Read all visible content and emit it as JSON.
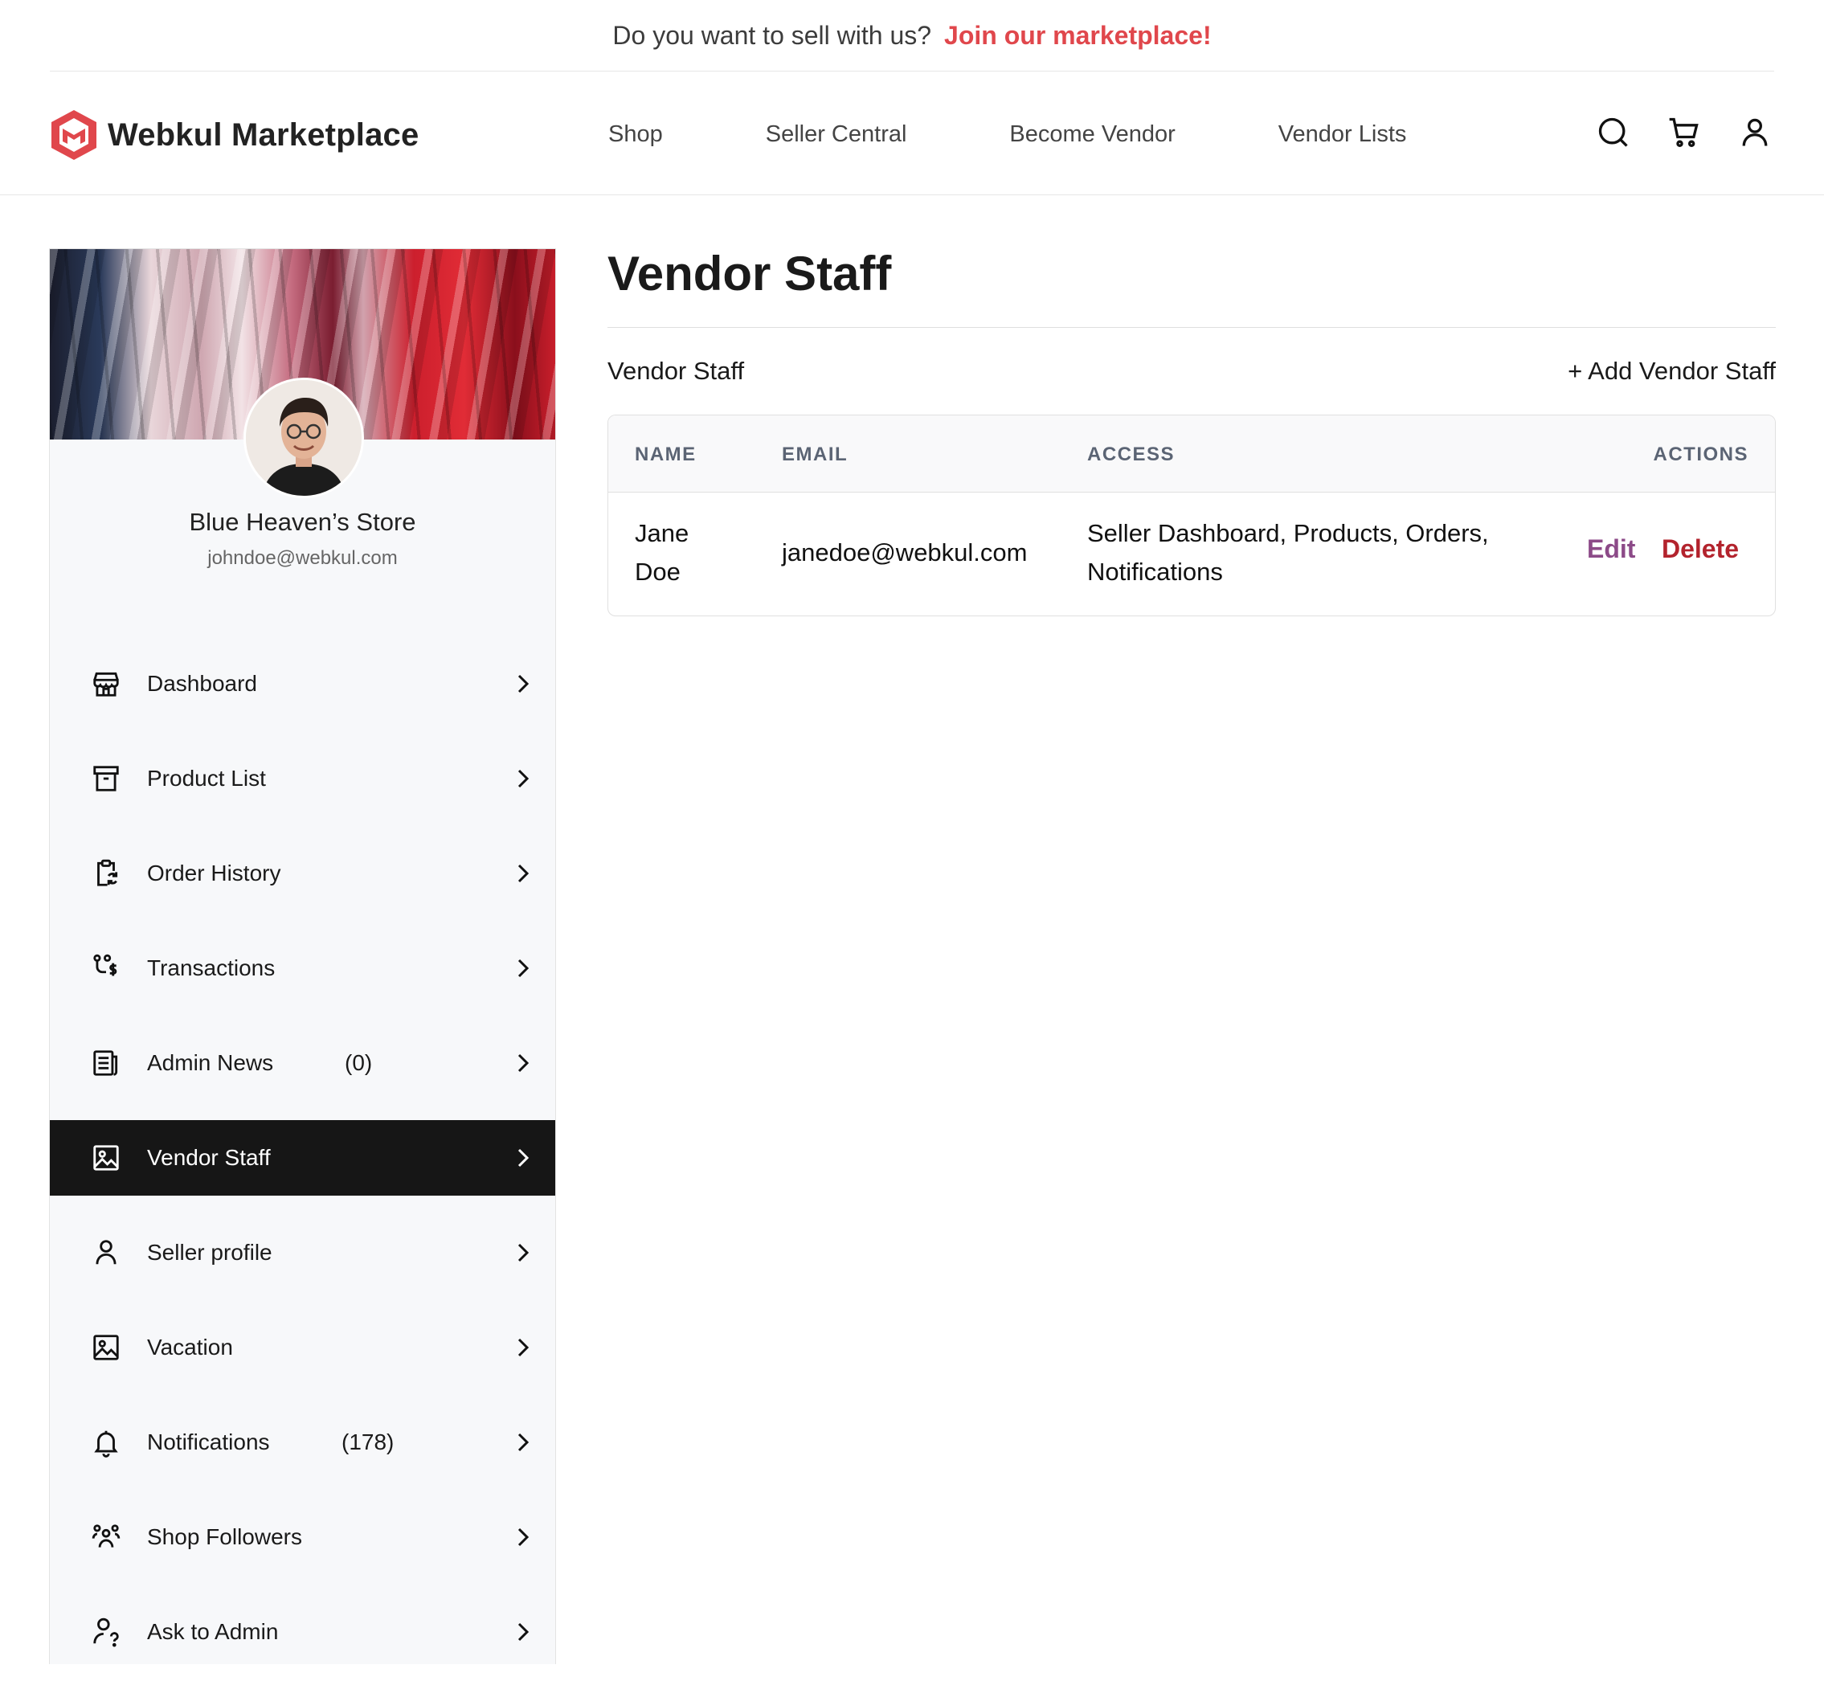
{
  "promo": {
    "text": "Do you want to sell with us?",
    "link": "Join our marketplace!"
  },
  "header": {
    "brand": "Webkul Marketplace",
    "nav": [
      "Shop",
      "Seller Central",
      "Become Vendor",
      "Vendor Lists"
    ],
    "icons": [
      "search-icon",
      "cart-icon",
      "user-icon"
    ]
  },
  "sidebar": {
    "store_name": "Blue Heaven’s Store",
    "store_email": "johndoe@webkul.com",
    "items": [
      {
        "label": "Dashboard",
        "icon": "store-icon"
      },
      {
        "label": "Product List",
        "icon": "archive-icon"
      },
      {
        "label": "Order History",
        "icon": "clipboard-sync-icon"
      },
      {
        "label": "Transactions",
        "icon": "transaction-dollar-icon"
      },
      {
        "label": "Admin News",
        "count": "(0)",
        "icon": "news-icon"
      },
      {
        "label": "Vendor Staff",
        "icon": "image-icon",
        "active": true
      },
      {
        "label": "Seller profile",
        "icon": "user-icon"
      },
      {
        "label": "Vacation",
        "icon": "image-icon"
      },
      {
        "label": "Notifications",
        "count": "(178)",
        "icon": "bell-icon"
      },
      {
        "label": "Shop Followers",
        "icon": "users-icon"
      },
      {
        "label": "Ask to Admin",
        "icon": "user-question-icon"
      }
    ]
  },
  "main": {
    "title": "Vendor Staff",
    "section_title": "Vendor Staff",
    "add_button": "+ Add Vendor Staff",
    "table": {
      "headers": [
        "NAME",
        "EMAIL",
        "ACCESS",
        "ACTIONS"
      ],
      "rows": [
        {
          "name": "Jane Doe",
          "email": "janedoe@webkul.com",
          "access": "Seller Dashboard, Products, Orders, Notifications",
          "edit": "Edit",
          "delete": "Delete"
        }
      ]
    }
  },
  "colors": {
    "accent_red": "#e0474c",
    "edit_purple": "#8c4a88",
    "delete_red": "#b3232d",
    "active_bg": "#161616"
  }
}
